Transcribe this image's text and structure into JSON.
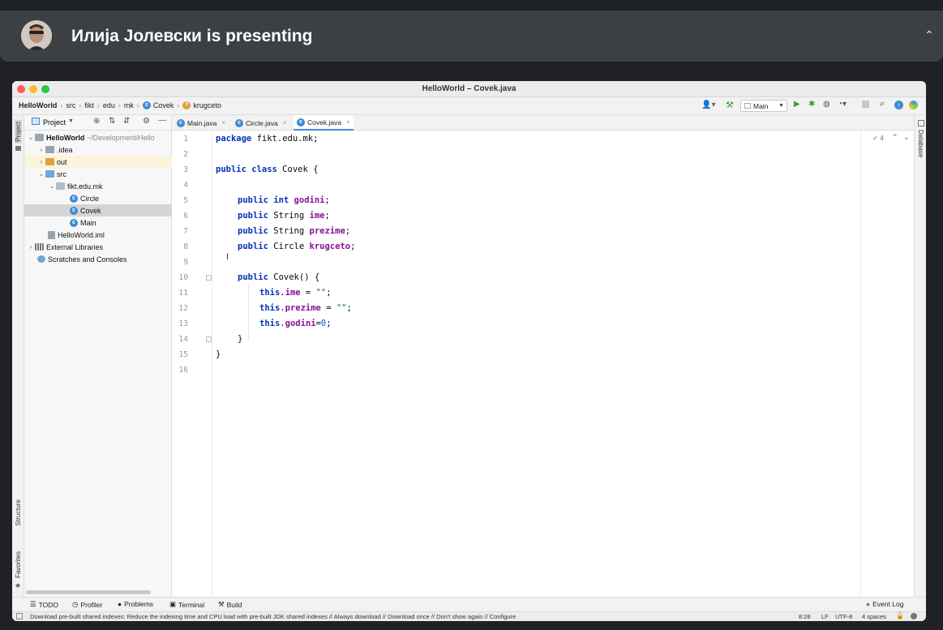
{
  "presenter": {
    "name": "Илија Јолевски is presenting"
  },
  "window": {
    "title": "HelloWorld – Covek.java"
  },
  "breadcrumb": [
    "HelloWorld",
    "src",
    "fikt",
    "edu",
    "mk",
    "Covek",
    "krugceto"
  ],
  "toolbar": {
    "run_config": "Main"
  },
  "project_panel": {
    "title": "Project",
    "root_label": "HelloWorld",
    "root_path": "~/Development/Hello",
    "items": [
      ".idea",
      "out",
      "src",
      "fikt.edu.mk",
      "Circle",
      "Covek",
      "Main",
      "HelloWorld.iml",
      "External Libraries",
      "Scratches and Consoles"
    ]
  },
  "tabs": [
    "Main.java",
    "Circle.java",
    "Covek.java"
  ],
  "editor": {
    "inspection_count": "4",
    "line_numbers": [
      "1",
      "2",
      "3",
      "4",
      "5",
      "6",
      "7",
      "8",
      "9",
      "10",
      "11",
      "12",
      "13",
      "14",
      "15",
      "16"
    ]
  },
  "code": {
    "l1_kw": "package",
    "l1_rest": " fikt.edu.mk;",
    "l3_kw": "public class",
    "l3_rest": " Covek {",
    "l5_kw": "public int",
    "l5_fld": "godini",
    "semi": ";",
    "l6_kw": "public",
    "l6_type": " String ",
    "l6_fld": "ime",
    "l7_kw": "public",
    "l7_type": " String ",
    "l7_fld": "prezime",
    "l8_kw": "public",
    "l8_type": " Circle ",
    "l8_fld": "krugceto",
    "l10_kw": "public",
    "l10_rest": " Covek() {",
    "this": "this",
    "dot": ".",
    "l11_fld": "ime",
    "l11_eq": " = ",
    "l11_str": "\"\"",
    "l12_fld": "prezime",
    "l12_eq": " = ",
    "l12_str": "\"\"",
    "l13_fld": "godini",
    "l13_eq": "=",
    "l13_num": "0",
    "l14": "}",
    "l15": "}"
  },
  "bottom_tools": [
    "TODO",
    "Profiler",
    "Problems",
    "Terminal",
    "Build",
    "Event Log"
  ],
  "side_tools": {
    "left_top": "Project",
    "left_structure": "Structure",
    "left_favorites": "Favorites",
    "right": "Database"
  },
  "status": {
    "message": "Download pre-built shared indexes: Reduce the indexing time and CPU load with pre-built JDK shared indexes // Always download // Download once // Don't show again // Configure",
    "position": "8:28",
    "line_sep": "LF",
    "encoding": "UTF-8",
    "indent": "4 spaces"
  }
}
